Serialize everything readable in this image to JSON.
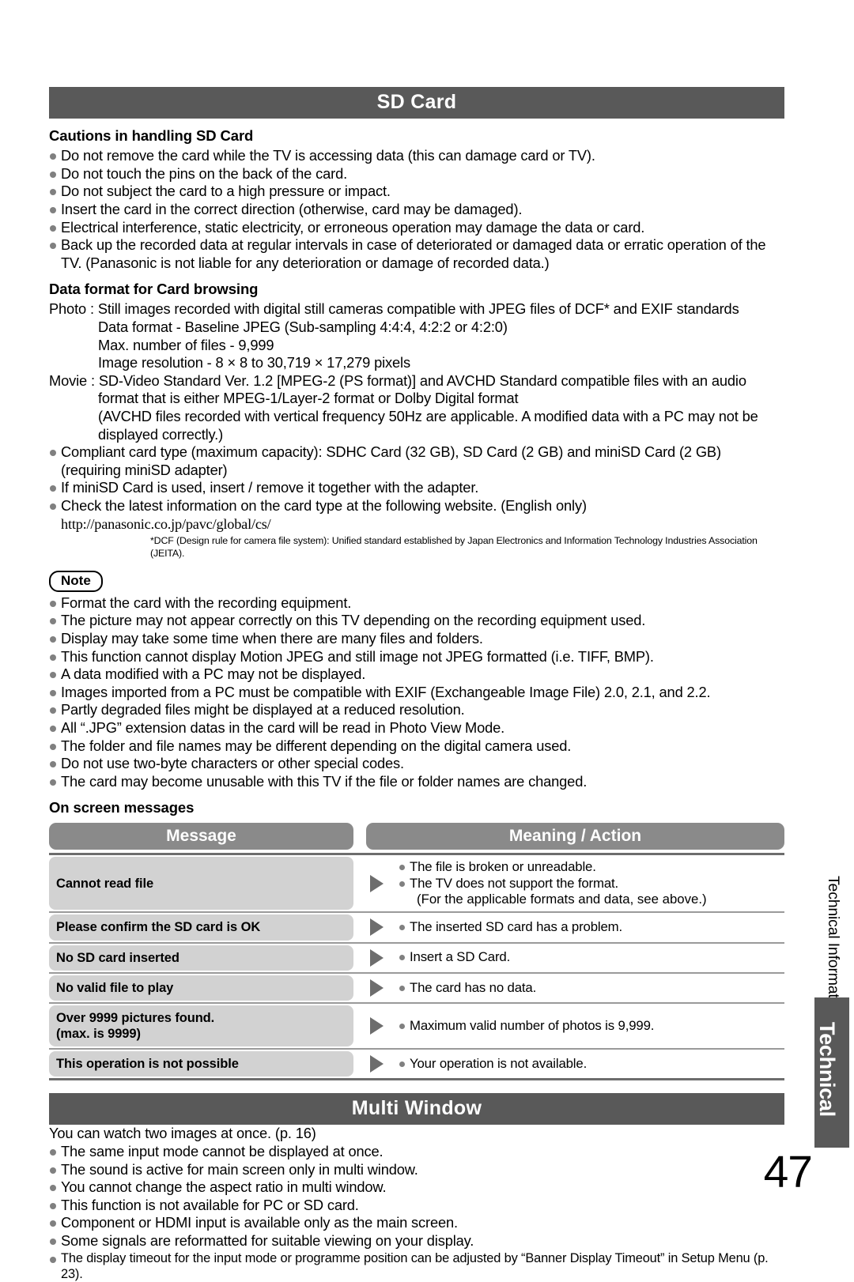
{
  "page": {
    "number": "47",
    "side_label": "Technical Information",
    "side_tab": "Technical",
    "banner_color": "#595959",
    "pill_color": "#8a8a8a",
    "row_color": "#d2d2d2",
    "bullet_color": "#808080"
  },
  "sd_card": {
    "banner": "SD Card",
    "cautions_heading": "Cautions in handling SD Card",
    "cautions": [
      "Do not remove the card while the TV is accessing data (this can damage card or TV).",
      "Do not touch the pins on the back of the card.",
      "Do not subject the card to a high pressure or impact.",
      "Insert the card in the correct direction (otherwise, card may be damaged).",
      "Electrical interference, static electricity, or erroneous operation may damage the data or card.",
      "Back up the recorded data at regular intervals in case of deteriorated or damaged data or erratic operation of the TV. (Panasonic is not liable for any deterioration or damage of recorded data.)"
    ],
    "data_format_heading": "Data format for Card browsing",
    "photo_label": "Photo :",
    "photo_main": "Still images recorded with digital still cameras compatible with JPEG files of DCF* and EXIF standards",
    "photo_details": [
      "Data format - Baseline JPEG (Sub-sampling 4:4:4, 4:2:2 or 4:2:0)",
      "Max. number of files - 9,999",
      "Image resolution - 8 × 8 to 30,719 × 17,279 pixels"
    ],
    "movie_label": "Movie :",
    "movie_main": "SD-Video Standard Ver. 1.2 [MPEG-2 (PS format)] and AVCHD Standard compatible files with an audio",
    "movie_details": [
      "format that is either MPEG-1/Layer-2 format or Dolby Digital format",
      "(AVCHD files recorded with vertical frequency 50Hz are applicable. A modified data with a PC may not be displayed correctly.)"
    ],
    "card_notes": [
      "Compliant card type (maximum capacity): SDHC Card (32 GB), SD Card (2 GB) and miniSD Card (2 GB) (requiring miniSD adapter)",
      "If miniSD Card is used, insert / remove it together with the adapter.",
      "Check the latest information on the card type at the following website. (English only)"
    ],
    "website": "http://panasonic.co.jp/pavc/global/cs/",
    "footnote": "*DCF (Design rule for camera file system): Unified standard established by Japan Electronics and Information Technology Industries Association (JEITA).",
    "note_label": "Note",
    "notes": [
      "Format the card with the recording equipment.",
      "The picture may not appear correctly on this TV depending on the recording equipment used.",
      "Display may take some time when there are many files and folders.",
      "This function cannot display Motion JPEG and still image not JPEG formatted (i.e. TIFF, BMP).",
      "A data modified with a PC may not be displayed.",
      "Images imported from a PC must be compatible with EXIF (Exchangeable Image File) 2.0, 2.1, and 2.2.",
      "Partly degraded files might be displayed at a reduced resolution.",
      "All “.JPG” extension datas in the card will be read in Photo View Mode.",
      "The folder and file names may be different depending on the digital camera used.",
      "Do not use two-byte characters or other special codes.",
      "The card may become unusable with this TV if the file or folder names are changed."
    ],
    "osm_heading": "On screen messages",
    "osm_columns": [
      "Message",
      "Meaning / Action"
    ],
    "osm_rows": [
      {
        "message": [
          "Cannot read file"
        ],
        "meanings": [
          "The file is broken or unreadable.",
          "The TV does not support the format."
        ],
        "sub": "(For the applicable formats and data, see above.)"
      },
      {
        "message": [
          "Please confirm the SD card is OK"
        ],
        "meanings": [
          "The inserted SD card has a problem."
        ],
        "sub": ""
      },
      {
        "message": [
          "No SD card inserted"
        ],
        "meanings": [
          "Insert a SD Card."
        ],
        "sub": ""
      },
      {
        "message": [
          "No valid file to play"
        ],
        "meanings": [
          "The card has no data."
        ],
        "sub": ""
      },
      {
        "message": [
          "Over 9999 pictures found.",
          "(max. is 9999)"
        ],
        "meanings": [
          "Maximum valid number of photos is 9,999."
        ],
        "sub": ""
      },
      {
        "message": [
          "This operation is not possible"
        ],
        "meanings": [
          "Your operation is not available."
        ],
        "sub": ""
      }
    ]
  },
  "multi_window": {
    "banner": "Multi Window",
    "intro": "You can watch two images at once. (p. 16)",
    "bullets": [
      "The same input mode cannot be displayed at once.",
      "The sound is active for main screen only in multi window.",
      "You cannot change the aspect ratio in multi window.",
      "This function is not available for PC or SD card.",
      "Component or HDMI input is available only as the main screen.",
      "Some signals are reformatted for suitable viewing on your display."
    ],
    "last_bullet": "The display timeout for the input mode or programme position can be adjusted by “Banner Display Timeout” in Setup Menu (p. 23)."
  }
}
